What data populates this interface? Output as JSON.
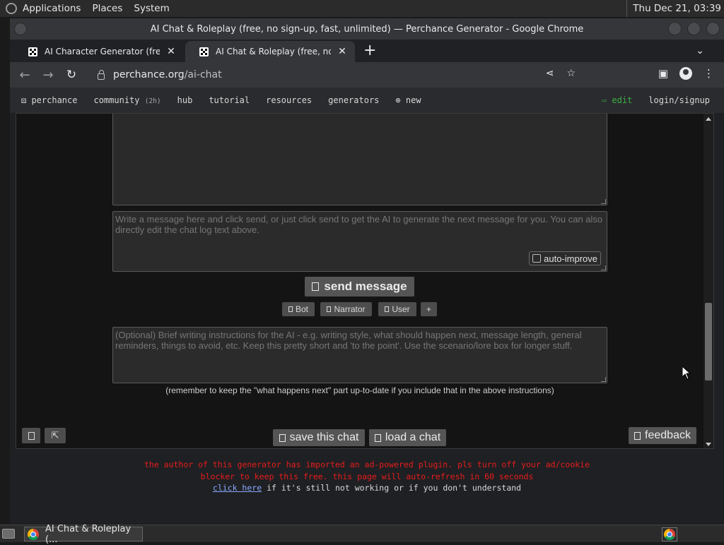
{
  "top_panel": {
    "menus": [
      "Applications",
      "Places",
      "System"
    ],
    "clock": "Thu Dec 21, 03:39"
  },
  "window": {
    "title": "AI Chat & Roleplay (free, no sign-up, fast, unlimited) — Perchance Generator - Google Chrome"
  },
  "tabs": [
    {
      "label": "AI Character Generator (free,"
    },
    {
      "label": "AI Chat & Roleplay (free, no si"
    }
  ],
  "toolbar": {
    "url_host": "perchance.org",
    "url_path": "/ai-chat"
  },
  "site_nav": {
    "brand": "perchance",
    "community": "community",
    "community_badge": "(2h)",
    "hub": "hub",
    "tutorial": "tutorial",
    "resources": "resources",
    "generators": "generators",
    "new": "new",
    "edit": "edit",
    "login": "login/signup"
  },
  "chat": {
    "message_placeholder": "Write a message here and click send, or just click send to get the AI to generate the next message for you. You can also directly edit the chat log text above.",
    "auto_improve": "auto-improve",
    "send_label": "send message",
    "bot_label": "Bot",
    "narrator_label": "Narrator",
    "user_label": "User",
    "add_label": "+",
    "instructions_placeholder": "(Optional) Brief writing instructions for the AI - e.g. writing style, what should happen next, message length, general reminders, things to avoid, etc. Keep this pretty short and 'to the point'. Use the scenario/lore box for longer stuff.",
    "instructions_note": "(remember to keep the \"what happens next\" part up-to-date if you include that in the above instructions)",
    "corner_icon_2": "⇱",
    "save_label": "save this chat",
    "load_label": "load a chat",
    "feedback_label": "feedback"
  },
  "ad_notice": {
    "line1": "the author of this generator has imported an ad-powered plugin. pls turn off your ad/cookie",
    "line2": "blocker to keep this free. this page will auto-refresh in 60 seconds",
    "link": "click here",
    "line3_rest": " if it's still not working or if you don't understand"
  },
  "taskbar": {
    "task_label": "AI Chat & Roleplay (..."
  },
  "colors": {
    "ad_red": "#e81c1c",
    "edit_green": "#3cb043",
    "link_blue": "#8aa9ff"
  }
}
